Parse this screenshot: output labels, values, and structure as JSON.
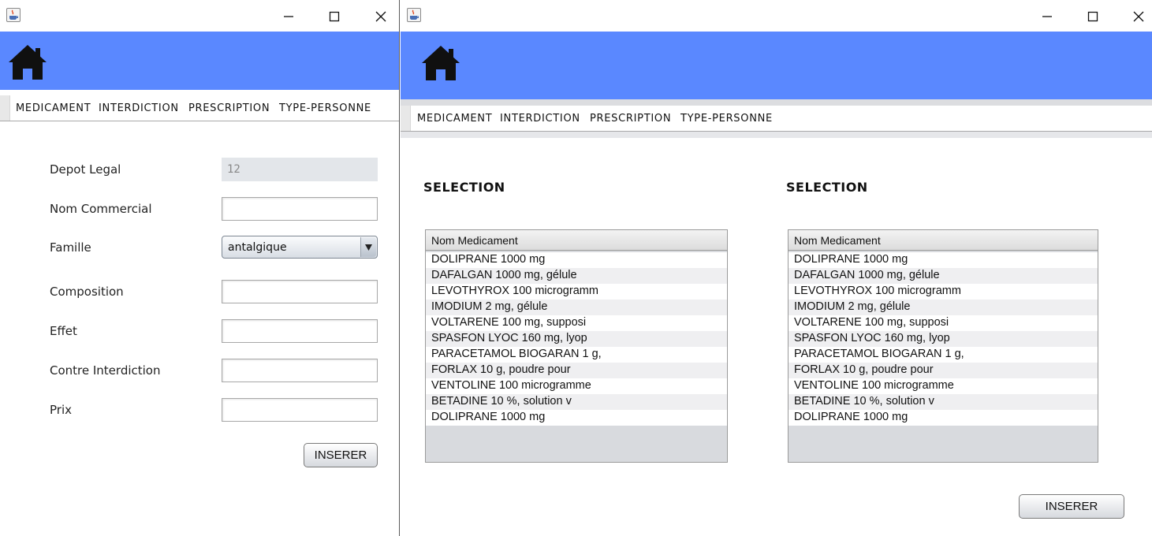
{
  "window_left": {
    "menu": [
      "MEDICAMENT",
      "INTERDICTION",
      "PRESCRIPTION",
      "TYPE-PERSONNE"
    ],
    "form": {
      "depot_legal": {
        "label": "Depot Legal",
        "value": "12"
      },
      "nom_commercial": {
        "label": "Nom Commercial",
        "value": ""
      },
      "famille": {
        "label": "Famille",
        "selected": "antalgique"
      },
      "composition": {
        "label": "Composition",
        "value": ""
      },
      "effet": {
        "label": "Effet",
        "value": ""
      },
      "contre_interdiction": {
        "label": "Contre Interdiction",
        "value": ""
      },
      "prix": {
        "label": "Prix",
        "value": ""
      }
    },
    "insert_button": "INSERER"
  },
  "window_right": {
    "menu": [
      "MEDICAMENT",
      "INTERDICTION",
      "PRESCRIPTION",
      "TYPE-PERSONNE"
    ],
    "panels": [
      {
        "title": "SELECTION",
        "column_header": "Nom Medicament",
        "rows": [
          "DOLIPRANE 1000 mg",
          "DAFALGAN 1000 mg, gélule",
          "LEVOTHYROX 100 microgramm",
          "IMODIUM 2 mg, gélule",
          "VOLTARENE 100 mg, supposi",
          "SPASFON LYOC 160 mg, lyop",
          "PARACETAMOL BIOGARAN 1 g,",
          "FORLAX 10 g, poudre pour",
          "VENTOLINE 100 microgramme",
          "BETADINE 10 %, solution v",
          "DOLIPRANE 1000 mg"
        ]
      },
      {
        "title": "SELECTION",
        "column_header": "Nom Medicament",
        "rows": [
          "DOLIPRANE 1000 mg",
          "DAFALGAN 1000 mg, gélule",
          "LEVOTHYROX 100 microgramm",
          "IMODIUM 2 mg, gélule",
          "VOLTARENE 100 mg, supposi",
          "SPASFON LYOC 160 mg, lyop",
          "PARACETAMOL BIOGARAN 1 g,",
          "FORLAX 10 g, poudre pour",
          "VENTOLINE 100 microgramme",
          "BETADINE 10 %, solution v",
          "DOLIPRANE 1000 mg"
        ]
      }
    ],
    "insert_button": "INSERER"
  },
  "icons": {
    "app": "java-coffee-cup-icon",
    "home": "home-icon",
    "minimize": "minimize-icon",
    "maximize": "maximize-icon",
    "close": "close-icon",
    "dropdown": "chevron-down-icon"
  },
  "colors": {
    "header_blue": "#5a88ff",
    "list_background": "#d8dade",
    "disabled_field": "#e3e6ea"
  }
}
